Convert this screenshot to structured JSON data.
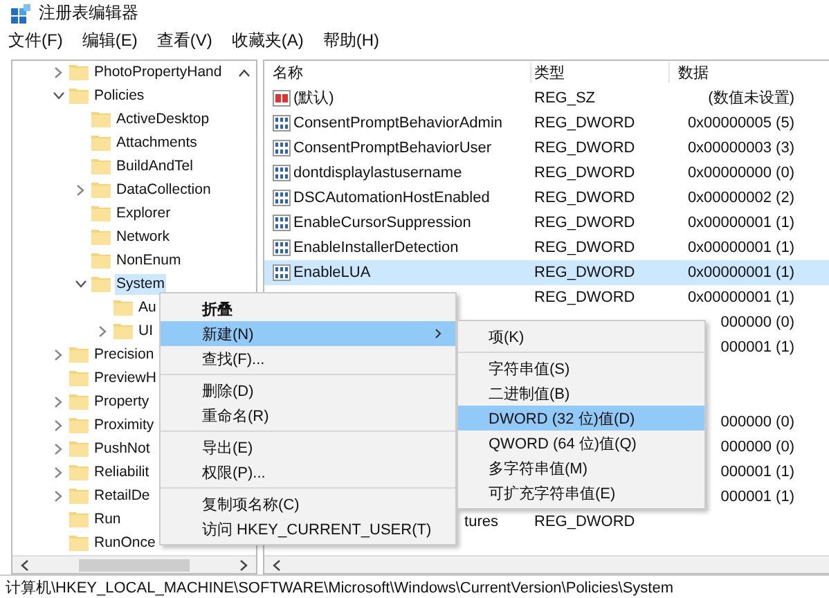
{
  "window": {
    "title": "注册表编辑器"
  },
  "menu_bar": [
    "文件(F)",
    "编辑(E)",
    "查看(V)",
    "收藏夹(A)",
    "帮助(H)"
  ],
  "tree": {
    "items": [
      {
        "label": "PhotoPropertyHand",
        "kind": "collapsed",
        "selected": false
      },
      {
        "label": "Policies",
        "kind": "expanded",
        "selected": false,
        "children": [
          {
            "label": "ActiveDesktop",
            "kind": "leaf",
            "selected": false
          },
          {
            "label": "Attachments",
            "kind": "leaf",
            "selected": false
          },
          {
            "label": "BuildAndTel",
            "kind": "leaf",
            "selected": false
          },
          {
            "label": "DataCollection",
            "kind": "collapsed",
            "selected": false
          },
          {
            "label": "Explorer",
            "kind": "leaf",
            "selected": false
          },
          {
            "label": "Network",
            "kind": "leaf",
            "selected": false
          },
          {
            "label": "NonEnum",
            "kind": "leaf",
            "selected": false
          },
          {
            "label": "System",
            "kind": "expanded",
            "selected": true,
            "children": [
              {
                "label": "Au",
                "kind": "leaf",
                "selected": false
              },
              {
                "label": "UI",
                "kind": "collapsed",
                "selected": false
              }
            ]
          }
        ]
      },
      {
        "label": "Precision",
        "kind": "collapsed",
        "selected": false
      },
      {
        "label": "PreviewH",
        "kind": "leaf",
        "selected": false
      },
      {
        "label": "Property",
        "kind": "collapsed",
        "selected": false
      },
      {
        "label": "Proximity",
        "kind": "collapsed",
        "selected": false
      },
      {
        "label": "PushNot",
        "kind": "collapsed",
        "selected": false
      },
      {
        "label": "Reliabilit",
        "kind": "collapsed",
        "selected": false
      },
      {
        "label": "RetailDe",
        "kind": "collapsed",
        "selected": false
      },
      {
        "label": "Run",
        "kind": "leaf",
        "selected": false
      },
      {
        "label": "RunOnce",
        "kind": "leaf",
        "selected": false
      }
    ]
  },
  "values": {
    "columns": [
      "名称",
      "类型",
      "数据"
    ],
    "rows": [
      {
        "kind": "string",
        "name": "(默认)",
        "type": "REG_SZ",
        "data": "(数值未设置)",
        "selected": false
      },
      {
        "kind": "dword",
        "name": "ConsentPromptBehaviorAdmin",
        "type": "REG_DWORD",
        "data": "0x00000005 (5)",
        "selected": false
      },
      {
        "kind": "dword",
        "name": "ConsentPromptBehaviorUser",
        "type": "REG_DWORD",
        "data": "0x00000003 (3)",
        "selected": false
      },
      {
        "kind": "dword",
        "name": "dontdisplaylastusername",
        "type": "REG_DWORD",
        "data": "0x00000000 (0)",
        "selected": false
      },
      {
        "kind": "dword",
        "name": "DSCAutomationHostEnabled",
        "type": "REG_DWORD",
        "data": "0x00000002 (2)",
        "selected": false
      },
      {
        "kind": "dword",
        "name": "EnableCursorSuppression",
        "type": "REG_DWORD",
        "data": "0x00000001 (1)",
        "selected": false
      },
      {
        "kind": "dword",
        "name": "EnableInstallerDetection",
        "type": "REG_DWORD",
        "data": "0x00000001 (1)",
        "selected": false
      },
      {
        "kind": "dword",
        "name": "EnableLUA",
        "type": "REG_DWORD",
        "data": "0x00000001 (1)",
        "selected": true
      },
      {
        "type": "REG_DWORD",
        "data": "0x00000001 (1)",
        "selected": false
      },
      {
        "data": "000000 (0)",
        "selected": false
      },
      {
        "data": "000001 (1)",
        "selected": false
      },
      {
        "selected": false
      },
      {
        "selected": false
      },
      {
        "data": "000000 (0)",
        "selected": false
      },
      {
        "data": "000000 (0)",
        "selected": false
      },
      {
        "data": "000001 (1)",
        "selected": false
      },
      {
        "data": "000001 (1)",
        "selected": false
      },
      {
        "name": "tures",
        "name_cut_left": true,
        "type": "REG_DWORD",
        "selected": false
      }
    ]
  },
  "context_menu": {
    "groups": [
      [
        {
          "label": "折叠",
          "default": true,
          "submenu": false,
          "selected": false
        },
        {
          "label": "新建(N)",
          "default": false,
          "submenu": true,
          "selected": true
        },
        {
          "label": "查找(F)...",
          "default": false,
          "submenu": false,
          "selected": false
        }
      ],
      [
        {
          "label": "删除(D)",
          "default": false,
          "submenu": false,
          "selected": false
        },
        {
          "label": "重命名(R)",
          "default": false,
          "submenu": false,
          "selected": false
        }
      ],
      [
        {
          "label": "导出(E)",
          "default": false,
          "submenu": false,
          "selected": false
        },
        {
          "label": "权限(P)...",
          "default": false,
          "submenu": false,
          "selected": false
        }
      ],
      [
        {
          "label": "复制项名称(C)",
          "default": false,
          "submenu": false,
          "selected": false
        },
        {
          "label": "访问 HKEY_CURRENT_USER(T)",
          "default": false,
          "submenu": false,
          "selected": false
        }
      ]
    ]
  },
  "submenu": {
    "groups": [
      [
        {
          "label": "项(K)",
          "selected": false
        }
      ],
      [
        {
          "label": "字符串值(S)",
          "selected": false
        },
        {
          "label": "二进制值(B)",
          "selected": false
        },
        {
          "label": "DWORD (32 位)值(D)",
          "selected": true
        },
        {
          "label": "QWORD (64 位)值(Q)",
          "selected": false
        },
        {
          "label": "多字符串值(M)",
          "selected": false
        },
        {
          "label": "可扩充字符串值(E)",
          "selected": false
        }
      ]
    ]
  },
  "status_bar": "计算机\\HKEY_LOCAL_MACHINE\\SOFTWARE\\Microsoft\\Windows\\CurrentVersion\\Policies\\System"
}
